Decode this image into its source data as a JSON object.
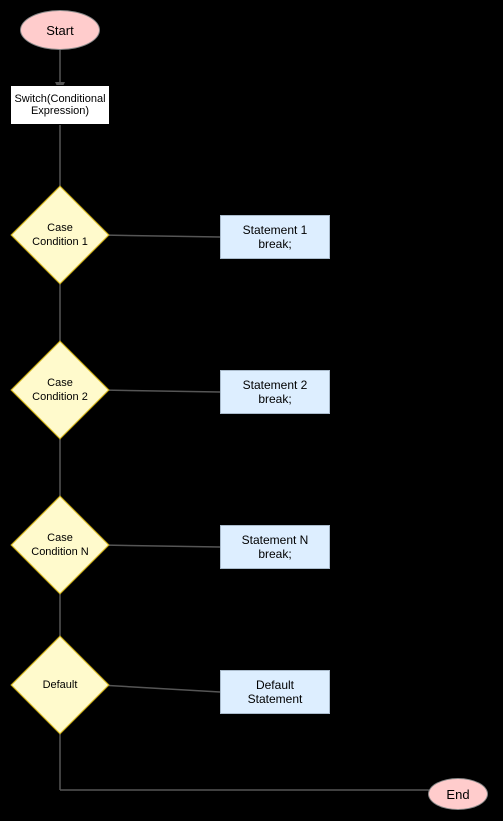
{
  "start_label": "Start",
  "end_label": "End",
  "switch_label": "Switch(Conditional\nExpression)",
  "diamonds": [
    {
      "id": "diamond-1",
      "label": "Case\nCondition 1"
    },
    {
      "id": "diamond-2",
      "label": "Case\nCondition 2"
    },
    {
      "id": "diamond-3",
      "label": "Case\nCondition N"
    },
    {
      "id": "diamond-4",
      "label": "Default"
    }
  ],
  "statements": [
    {
      "id": "stmt-1",
      "label": "Statement 1\nbreak;"
    },
    {
      "id": "stmt-2",
      "label": "Statement 2\nbreak;"
    },
    {
      "id": "stmt-3",
      "label": "Statement N\nbreak;"
    },
    {
      "id": "stmt-4",
      "label": "Default\nStatement"
    }
  ]
}
